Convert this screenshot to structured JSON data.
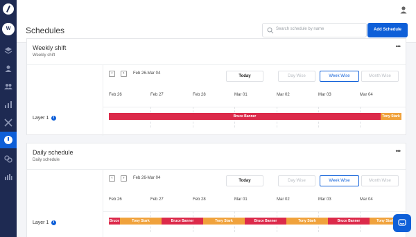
{
  "sidebar": {
    "avatar": "W",
    "icons": [
      "layers-icon",
      "user-icon",
      "team-icon",
      "analytics-icon",
      "tools-icon",
      "schedules-icon",
      "integrations-icon",
      "reports-icon"
    ]
  },
  "header": {
    "title": "Schedules",
    "search_placeholder": "Search schedule by name",
    "add_button": "Add Schedule"
  },
  "schedules": [
    {
      "title": "Weekly shift",
      "subtitle": "Weekly shift",
      "range": "Feb 26-Mar 04",
      "today": "Today",
      "views": [
        "Day Wise",
        "Week Wise",
        "Month Wise"
      ],
      "active_view": "Week Wise",
      "days": [
        "Feb 26",
        "Feb 27",
        "Feb 28",
        "Mar 01",
        "Mar 02",
        "Mar 03",
        "Mar 04"
      ],
      "layer": "Layer 1",
      "shifts": [
        {
          "name": "Bruce Banner",
          "color": "#dc2a4a"
        },
        {
          "name": "Tony Stark",
          "color": "#f0a23c"
        }
      ]
    },
    {
      "title": "Daily schedule",
      "subtitle": "Daily schedule",
      "range": "Feb 26-Mar 04",
      "today": "Today",
      "views": [
        "Day Wise",
        "Week Wise",
        "Month Wise"
      ],
      "active_view": "Week Wise",
      "days": [
        "Feb 26",
        "Feb 27",
        "Feb 28",
        "Mar 01",
        "Mar 02",
        "Mar 03",
        "Mar 04"
      ],
      "layer": "Layer 1",
      "shifts": [
        {
          "name": "Bruce",
          "color": "#dc2a4a"
        },
        {
          "name": "Tony Stark",
          "color": "#f0a23c"
        },
        {
          "name": "Bruce Banner",
          "color": "#dc2a4a"
        },
        {
          "name": "Tony Stark",
          "color": "#f0a23c"
        },
        {
          "name": "Bruce Banner",
          "color": "#dc2a4a"
        },
        {
          "name": "Tony Stark",
          "color": "#f0a23c"
        },
        {
          "name": "Bruce Banner",
          "color": "#dc2a4a"
        },
        {
          "name": "Tony Stark",
          "color": "#f0a23c"
        }
      ]
    }
  ],
  "colors": {
    "accent": "#0e5fd8",
    "sidebar": "#1e2a52",
    "bruce": "#dc2a4a",
    "tony": "#f0a23c"
  }
}
